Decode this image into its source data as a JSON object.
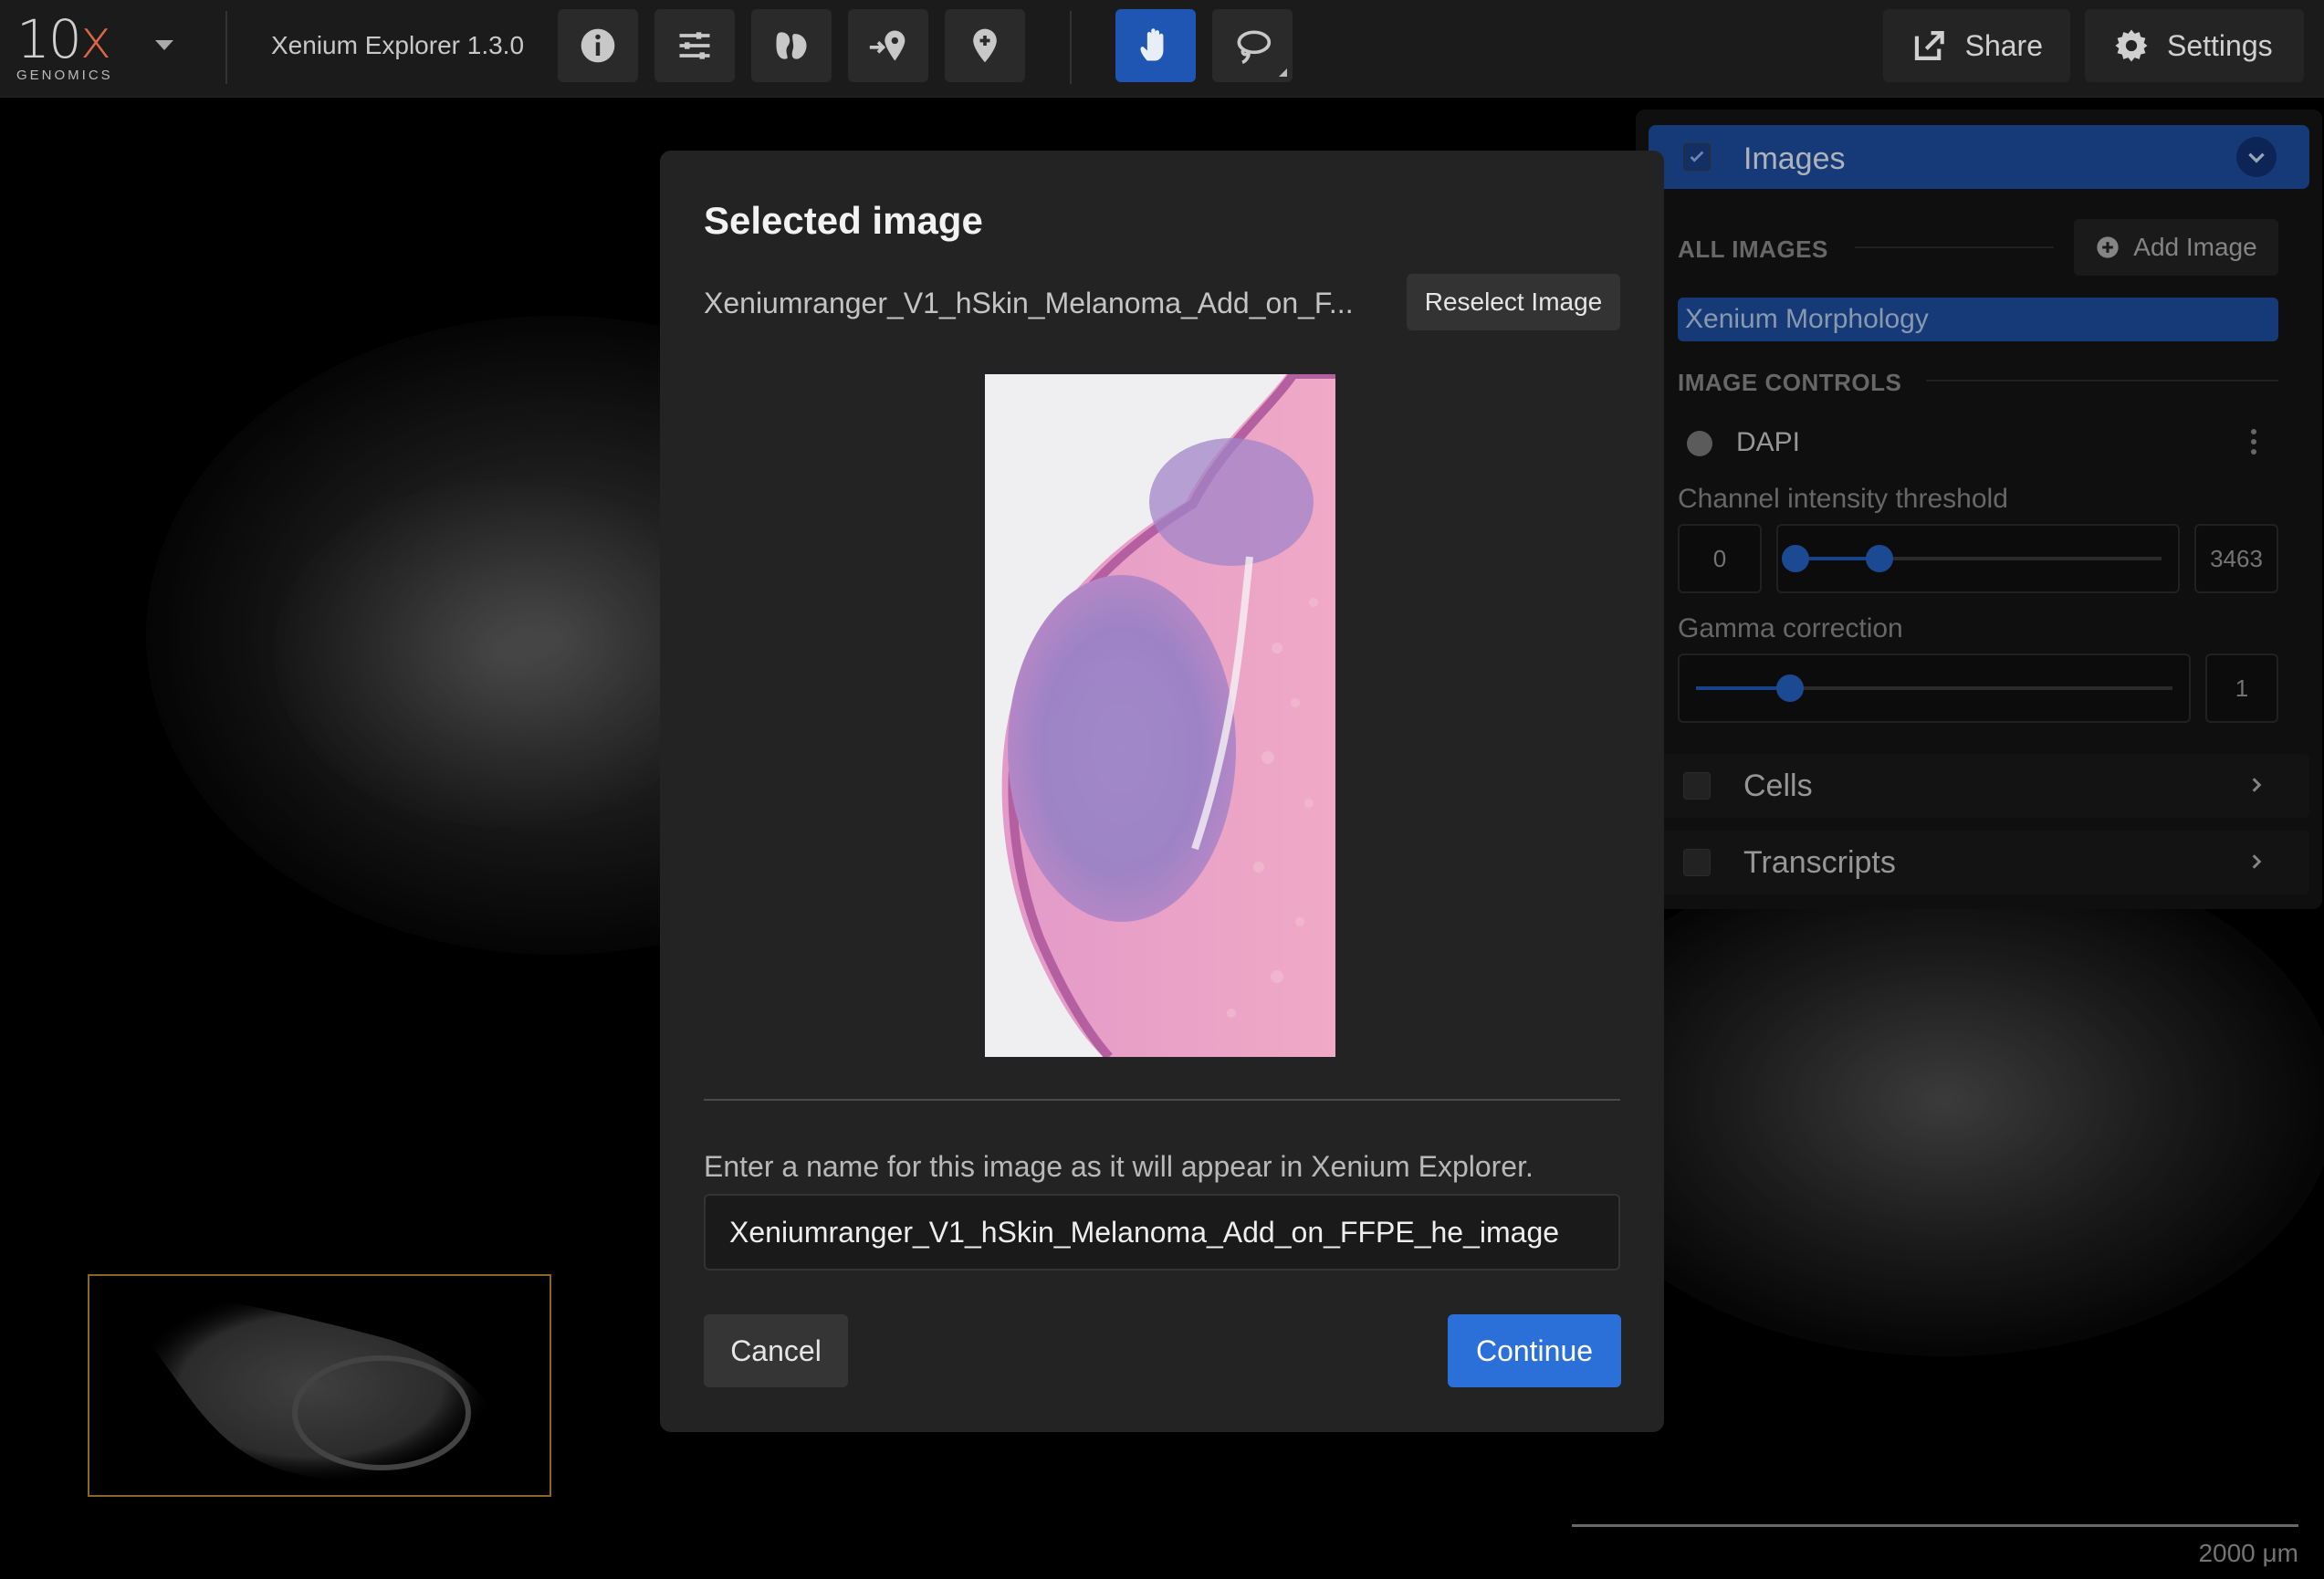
{
  "header": {
    "logo_main": "10",
    "logo_x": "x",
    "logo_sub": "GENOMICS",
    "app_title": "Xenium Explorer 1.3.0",
    "share_label": "Share",
    "settings_label": "Settings"
  },
  "panel": {
    "images_title": "Images",
    "all_images_label": "ALL IMAGES",
    "add_image_label": "Add Image",
    "selected_image": "Xenium Morphology",
    "image_controls_label": "IMAGE CONTROLS",
    "channel_name": "DAPI",
    "threshold_label": "Channel intensity threshold",
    "threshold_min": "0",
    "threshold_max": "3463",
    "gamma_label": "Gamma correction",
    "gamma_value": "1",
    "cells_label": "Cells",
    "transcripts_label": "Transcripts"
  },
  "scale": {
    "label": "2000  μm"
  },
  "modal": {
    "title": "Selected image",
    "file_name": "Xeniumranger_V1_hSkin_Melanoma_Add_on_F...",
    "reselect_label": "Reselect Image",
    "prompt": "Enter a name for this image as it will appear in Xenium Explorer.",
    "name_value": "Xeniumranger_V1_hSkin_Melanoma_Add_on_FFPE_he_image",
    "cancel_label": "Cancel",
    "continue_label": "Continue"
  },
  "colors": {
    "accent": "#2b6fd8",
    "panel_header": "#1e4ea1",
    "minimap_border": "#b8892e"
  }
}
